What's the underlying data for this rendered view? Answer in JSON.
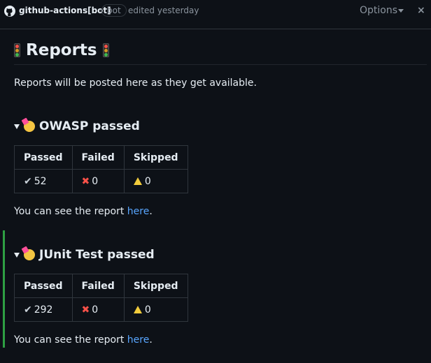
{
  "header": {
    "author": "github-actions[bot]",
    "badge": "bot",
    "edited": "edited yesterday",
    "options_label": "Options",
    "close_glyph": "×"
  },
  "main": {
    "title": "Reports",
    "intro": "Reports will be posted here as they get available.",
    "sections": [
      {
        "summary": "OWASP passed",
        "columns": [
          "Passed",
          "Failed",
          "Skipped"
        ],
        "passed": "52",
        "failed": "0",
        "skipped": "0",
        "footer_text": "You can see the report ",
        "link_text": "here",
        "period": "."
      },
      {
        "summary": "JUnit Test passed",
        "columns": [
          "Passed",
          "Failed",
          "Skipped"
        ],
        "passed": "292",
        "failed": "0",
        "skipped": "0",
        "footer_text": "You can see the report ",
        "link_text": "here",
        "period": "."
      }
    ]
  },
  "icons": {
    "check": "✔",
    "cross": "✖"
  },
  "colors": {
    "background": "#0d1117",
    "link": "#58a6ff",
    "border": "#30363d",
    "accent_bar": "#2ea043"
  }
}
